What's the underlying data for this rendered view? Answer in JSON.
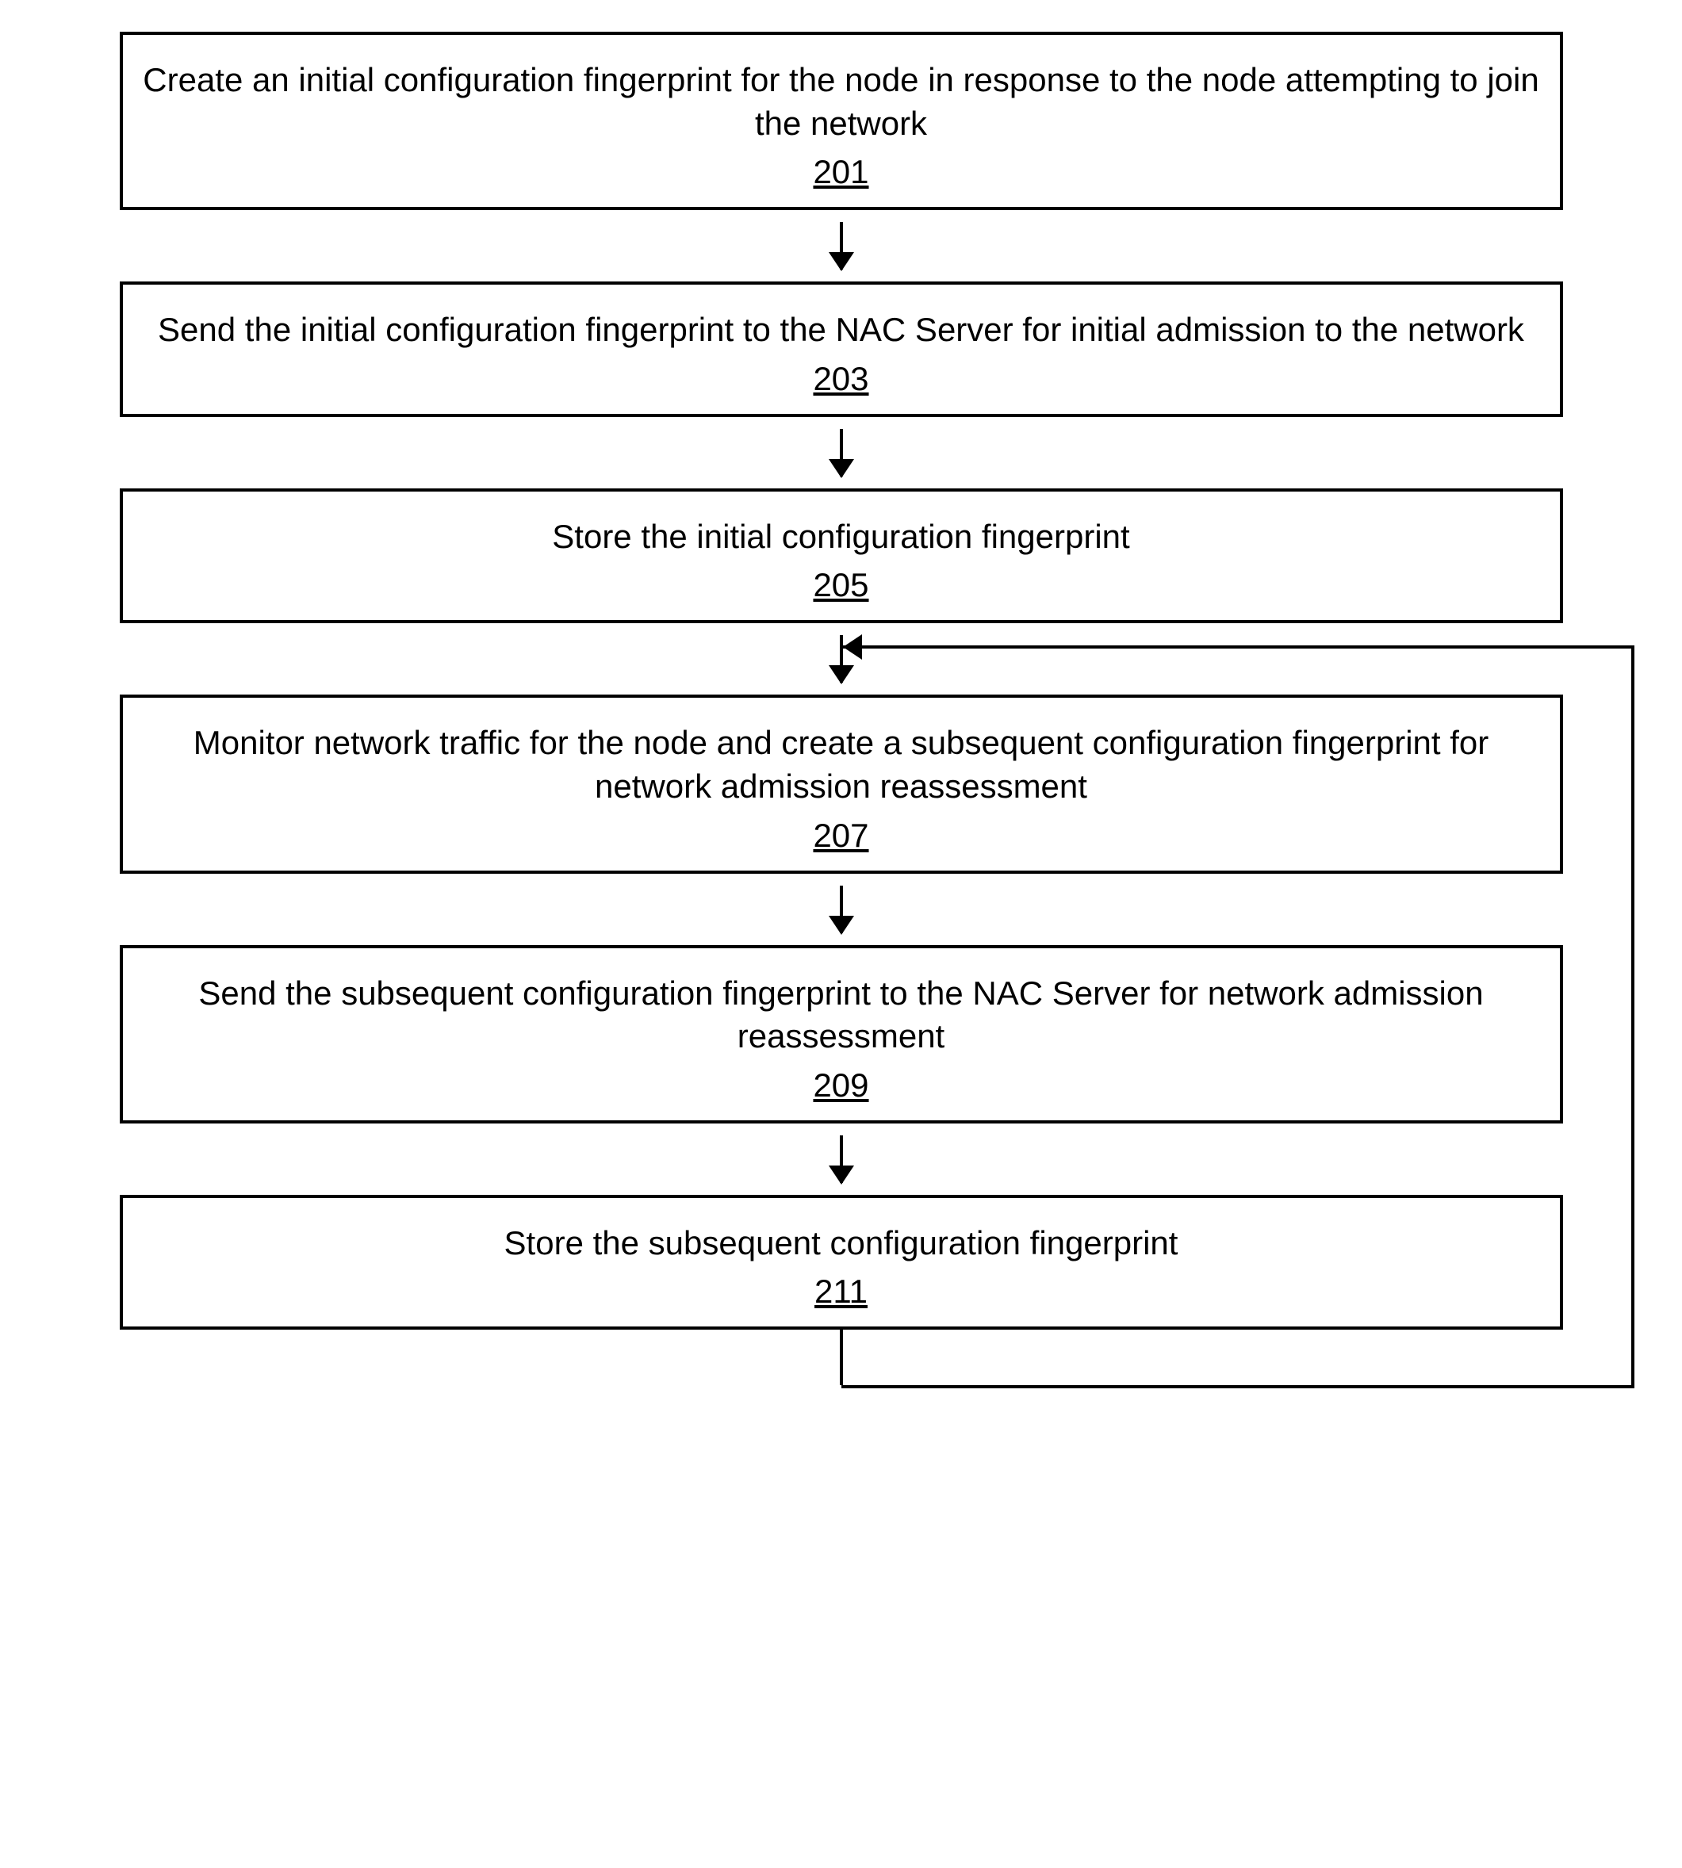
{
  "chart_data": {
    "type": "flowchart",
    "nodes": [
      {
        "id": "201",
        "text": "Create an initial configuration fingerprint for the node in response to the node attempting to join the network"
      },
      {
        "id": "203",
        "text": "Send the initial configuration fingerprint to the NAC Server for initial admission to the network"
      },
      {
        "id": "205",
        "text": "Store the initial configuration fingerprint"
      },
      {
        "id": "207",
        "text": "Monitor network traffic for the node and create a subsequent configuration fingerprint for network admission reassessment"
      },
      {
        "id": "209",
        "text": "Send the subsequent configuration fingerprint to the NAC Server for network admission reassessment"
      },
      {
        "id": "211",
        "text": "Store the subsequent configuration fingerprint"
      }
    ],
    "edges": [
      {
        "from": "201",
        "to": "203"
      },
      {
        "from": "203",
        "to": "205"
      },
      {
        "from": "205",
        "to": "207"
      },
      {
        "from": "207",
        "to": "209"
      },
      {
        "from": "209",
        "to": "211"
      },
      {
        "from": "211",
        "to": "207",
        "feedback": true
      }
    ]
  }
}
